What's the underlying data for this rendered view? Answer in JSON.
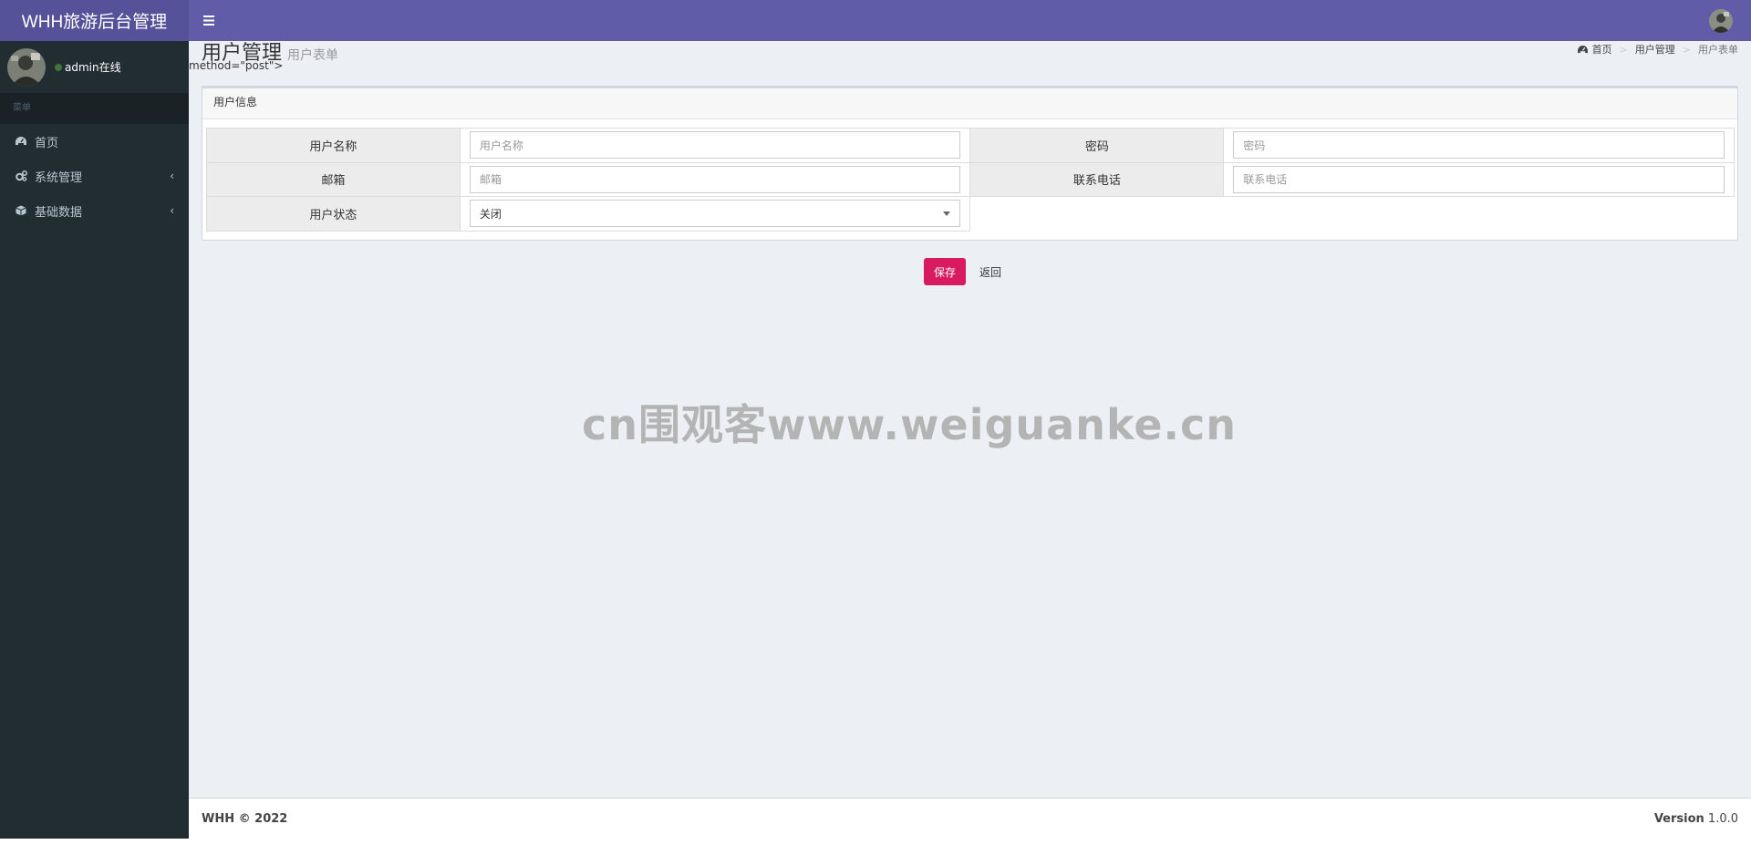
{
  "header": {
    "logo": "WHH旅游后台管理",
    "toggle_icon": "hamburger-icon",
    "avatar_icon": "user-avatar-icon"
  },
  "sidebar": {
    "user": {
      "status_text": "admin在线",
      "status_color": "#3c763d"
    },
    "menu_header": "菜单",
    "items": [
      {
        "label": "首页",
        "icon": "dashboard-icon"
      },
      {
        "label": "系统管理",
        "icon": "cogs-icon",
        "chevron": "‹"
      },
      {
        "label": "基础数据",
        "icon": "cube-icon",
        "chevron": "‹"
      }
    ]
  },
  "content": {
    "title": "用户管理",
    "subtitle": "用户表单",
    "stray_text": "method=\"post\">",
    "breadcrumb": [
      "首页",
      "用户管理",
      "用户表单"
    ],
    "box_title": "用户信息",
    "form": {
      "username_label": "用户名称",
      "username_placeholder": "用户名称",
      "password_label": "密码",
      "password_placeholder": "密码",
      "email_label": "邮箱",
      "email_placeholder": "邮箱",
      "phone_label": "联系电话",
      "phone_placeholder": "联系电话",
      "status_label": "用户状态",
      "status_value": "关闭"
    },
    "save_label": "保存",
    "back_label": "返回",
    "watermark": "cn围观客www.weiguanke.cn"
  },
  "footer": {
    "copyright": "WHH © 2022",
    "version_label": "Version",
    "version_value": "1.0.0"
  },
  "colors": {
    "header": "#605ca8",
    "logo_bg": "#555299",
    "sidebar": "#222d32",
    "save_button": "#d81b60"
  }
}
